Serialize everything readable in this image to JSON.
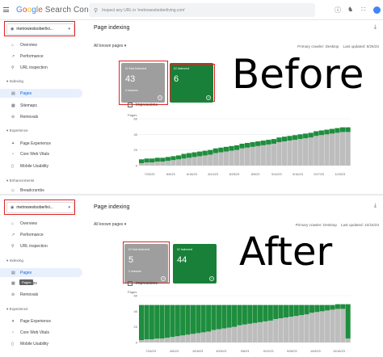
{
  "app": {
    "logo_parts": [
      "G",
      "o",
      "o",
      "g",
      "l",
      "e"
    ],
    "product": "Search Console",
    "search_placeholder": "Inspect any URL in 'metrowestsoberliving.com'"
  },
  "panels": [
    {
      "id": "before",
      "property": "metrowestsoberlivi...",
      "nav": [
        {
          "label": "Overview",
          "icon": "home-icon"
        },
        {
          "label": "Performance",
          "icon": "trend-icon"
        },
        {
          "label": "URL inspection",
          "icon": "magnifier-icon"
        }
      ],
      "sections": [
        {
          "title": "Indexing",
          "items": [
            "Pages",
            "Sitemaps",
            "Removals"
          ]
        },
        {
          "title": "Experience",
          "items": [
            "Page Experience",
            "Core Web Vitals",
            "Mobile Usability"
          ]
        },
        {
          "title": "Enhancements",
          "items": [
            "Breadcrumbs"
          ]
        }
      ],
      "title": "Page indexing",
      "filter": "All known pages",
      "crawler": "Primary crawler: Desktop",
      "last_updated": "Last updated: 8/26/23",
      "not_indexed_label": "Not indexed",
      "not_indexed_value": "43",
      "not_indexed_sub": "4 reasons",
      "indexed_label": "Indexed",
      "indexed_value": "6",
      "impressions": "Impressions",
      "overlay_text": "Before",
      "chart_ylabel": "Pages"
    },
    {
      "id": "after",
      "property": "metrowestsoberlivi...",
      "nav": [
        {
          "label": "Overview",
          "icon": "home-icon"
        },
        {
          "label": "Performance",
          "icon": "trend-icon"
        },
        {
          "label": "URL inspection",
          "icon": "magnifier-icon"
        }
      ],
      "sections": [
        {
          "title": "Indexing",
          "items": [
            "Pages",
            "Sitemaps",
            "Removals"
          ]
        },
        {
          "title": "Experience",
          "items": [
            "Page Experience",
            "Core Web Vitals",
            "Mobile Usability"
          ]
        }
      ],
      "tooltip": "Pages",
      "title": "Page indexing",
      "filter": "All known pages",
      "crawler": "Primary crawler: Desktop",
      "last_updated": "Last updated: 10/16/23",
      "not_indexed_label": "Not indexed",
      "not_indexed_value": "5",
      "not_indexed_sub": "2 reasons",
      "indexed_label": "Indexed",
      "indexed_value": "44",
      "impressions": "Impressions",
      "overlay_text": "After",
      "chart_ylabel": "Pages"
    }
  ],
  "chart_data": [
    {
      "type": "bar",
      "stacked": true,
      "ylabel": "Pages",
      "ylim": [
        0,
        60
      ],
      "yticks": [
        0,
        20,
        40,
        60
      ],
      "x_ticks": [
        "7/20/23",
        "8/5/23",
        "8/18/23",
        "8/14/23",
        "8/25/23",
        "8/5/23",
        "9/10/23",
        "9/16/23",
        "9/27/23",
        "10/3/23"
      ],
      "series": [
        {
          "name": "Not indexed",
          "color": "#bdbdbd",
          "values": [
            3,
            4,
            4,
            5,
            5,
            6,
            7,
            8,
            9,
            10,
            11,
            12,
            13,
            14,
            16,
            17,
            18,
            19,
            20,
            22,
            23,
            24,
            25,
            26,
            27,
            28,
            30,
            31,
            32,
            33,
            34,
            35,
            36,
            38,
            39,
            40,
            41,
            42,
            43,
            43
          ]
        },
        {
          "name": "Indexed",
          "color": "#1e8e3e",
          "values": [
            5,
            5,
            5,
            5,
            5,
            5,
            5,
            5,
            6,
            6,
            6,
            6,
            6,
            6,
            6,
            6,
            6,
            6,
            6,
            6,
            6,
            6,
            6,
            6,
            6,
            6,
            6,
            6,
            6,
            6,
            6,
            6,
            6,
            6,
            6,
            6,
            6,
            6,
            6,
            6
          ]
        }
      ]
    },
    {
      "type": "bar",
      "stacked": true,
      "ylabel": "Pages",
      "ylim": [
        0,
        60
      ],
      "yticks": [
        0,
        20,
        40,
        60
      ],
      "x_ticks": [
        "7/26/23",
        "8/6/23",
        "8/18/23",
        "8/25/23",
        "9/8/23",
        "9/12/23",
        "9/28/23",
        "10/5/23",
        "10/16/23"
      ],
      "series": [
        {
          "name": "Not indexed",
          "color": "#bdbdbd",
          "values": [
            3,
            4,
            4,
            5,
            5,
            6,
            7,
            8,
            9,
            10,
            11,
            12,
            13,
            14,
            16,
            17,
            18,
            19,
            20,
            22,
            23,
            24,
            25,
            26,
            27,
            28,
            30,
            31,
            32,
            33,
            34,
            35,
            36,
            38,
            39,
            40,
            41,
            42,
            43,
            43,
            5
          ]
        },
        {
          "name": "Indexed",
          "color": "#1e8e3e",
          "values": [
            45,
            44,
            44,
            43,
            43,
            42,
            41,
            40,
            39,
            38,
            37,
            36,
            35,
            34,
            32,
            31,
            30,
            29,
            28,
            26,
            25,
            24,
            23,
            22,
            21,
            20,
            18,
            17,
            16,
            15,
            14,
            13,
            12,
            10,
            9,
            8,
            7,
            6,
            6,
            6,
            44
          ]
        }
      ]
    }
  ],
  "colors": {
    "accent_red": "#e02424",
    "indexed_green": "#188038",
    "not_indexed_grey": "#9e9e9e",
    "active_nav": "#e8f0fe"
  }
}
